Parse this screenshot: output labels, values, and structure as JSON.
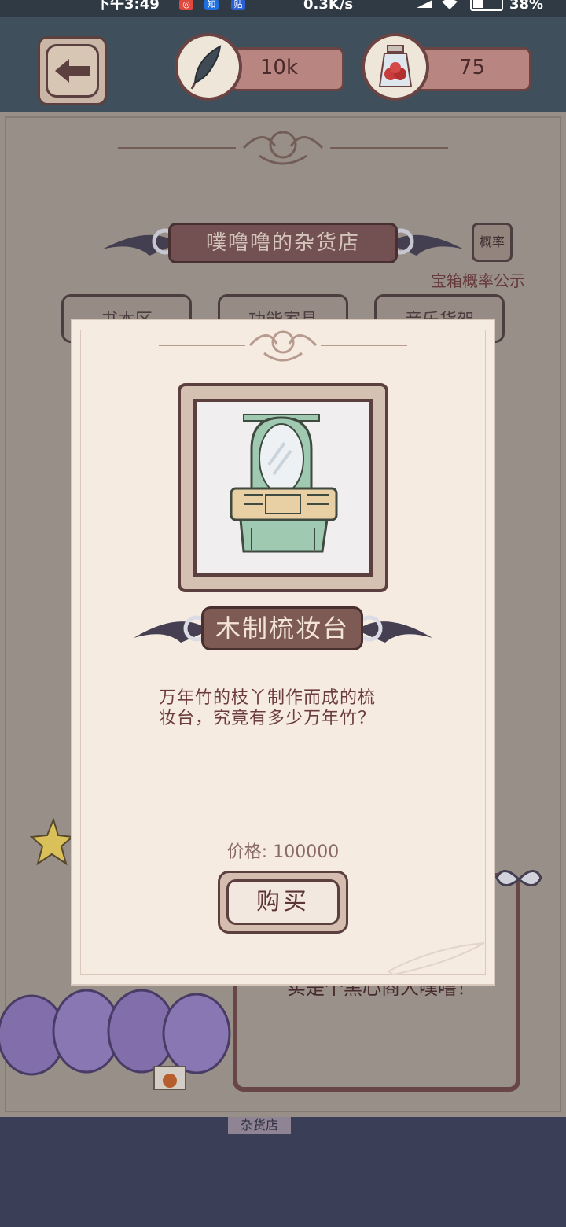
{
  "status_bar": {
    "time": "下午3:49",
    "net_speed": "0.3K/s",
    "battery": "38%",
    "app_icons": [
      "◎",
      "知",
      "贴"
    ]
  },
  "currencies": {
    "feather": "10k",
    "jar": "75"
  },
  "shop": {
    "title": "噗噜噜的杂货店",
    "prob_button": "概率",
    "prob_note": "宝箱概率公示",
    "tabs": [
      "书本区",
      "功能家具",
      "音乐货架"
    ],
    "speech": "实是个黑心商人噗噜！",
    "ground_sign": "杂货店"
  },
  "item": {
    "name": "木制梳妆台",
    "description_line1": "万年竹的枝丫制作而成的梳",
    "description_line2": "妆台，究竟有多少万年竹？",
    "price": "价格: 100000",
    "buy_label": "购买"
  },
  "colors": {
    "accent": "#7e5a55",
    "panel": "#f5ebe1",
    "text": "#6d3d3d"
  }
}
